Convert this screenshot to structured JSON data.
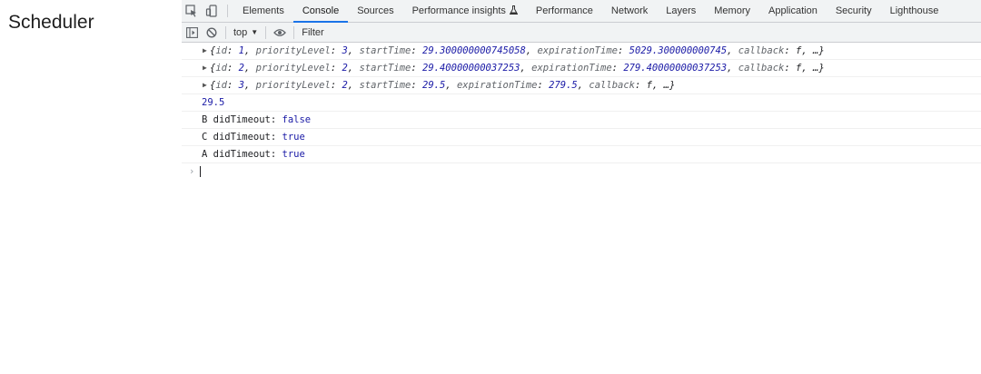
{
  "page_heading": "Scheduler",
  "tabs": [
    "Elements",
    "Console",
    "Sources",
    "Performance insights",
    "Performance",
    "Network",
    "Layers",
    "Memory",
    "Application",
    "Security",
    "Lighthouse"
  ],
  "active_tab": "Console",
  "toolbar": {
    "context": "top",
    "filter_placeholder": "Filter"
  },
  "console_entries": [
    {
      "id": "1",
      "priorityLevel": "3",
      "startTime": "29.300000000745058",
      "expirationTime": "5029.300000000745",
      "callback": "f",
      "rest": "…"
    },
    {
      "id": "2",
      "priorityLevel": "2",
      "startTime": "29.40000000037253",
      "expirationTime": "279.40000000037253",
      "callback": "f",
      "rest": "…"
    },
    {
      "id": "3",
      "priorityLevel": "2",
      "startTime": "29.5",
      "expirationTime": "279.5",
      "callback": "f",
      "rest": "…"
    }
  ],
  "plain_value": "29.5",
  "timeout_logs": [
    {
      "label": "B didTimeout:",
      "value": "false"
    },
    {
      "label": "C didTimeout:",
      "value": "true"
    },
    {
      "label": "A didTimeout:",
      "value": "true"
    }
  ],
  "prompt_symbol": "›",
  "icons": {
    "inspect": "inspect-element-icon",
    "device": "device-toolbar-icon",
    "sidebar": "show-sidebar-icon",
    "clear": "clear-console-icon",
    "eye": "live-expression-icon",
    "flask": "experimental-flask-icon"
  }
}
